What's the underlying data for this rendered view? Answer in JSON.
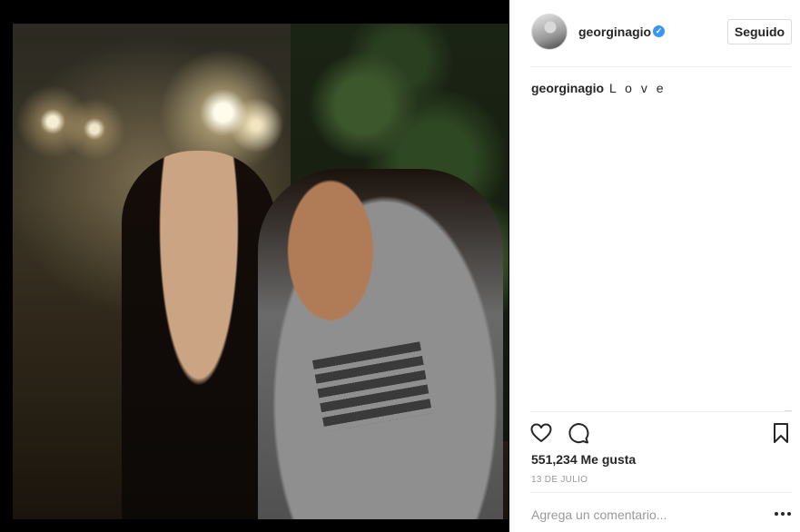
{
  "post": {
    "username": "georginagio",
    "verified_icon": "verified-badge-icon",
    "follow_label": "Seguido",
    "caption_user": "georginagio",
    "caption_text": "L o v e",
    "likes_text": "551,234 Me gusta",
    "date_text": "13 DE JULIO",
    "comment_placeholder": "Agrega un comentario...",
    "icons": {
      "like": "heart-icon",
      "comment": "comment-bubble-icon",
      "save": "bookmark-icon",
      "more": "more-options-icon"
    },
    "colors": {
      "text": "#262626",
      "verified": "#3897f0",
      "muted": "#999999",
      "border": "#dbdbdb"
    }
  }
}
